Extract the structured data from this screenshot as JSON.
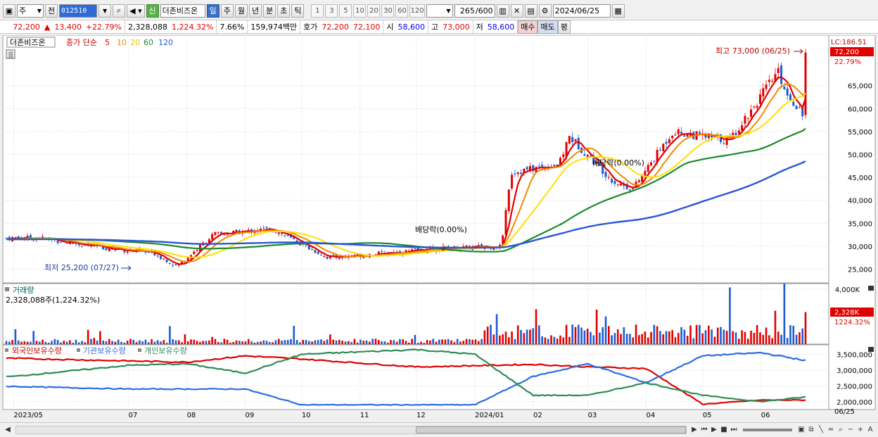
{
  "toolbar": {
    "market_select": "주",
    "prev_label": "전",
    "stock_code": "012510",
    "stock_name": "더존비즈온",
    "credit_badge": "신",
    "periods": [
      "일",
      "주",
      "월",
      "년",
      "분",
      "초",
      "틱"
    ],
    "active_period": "일",
    "intervals": [
      "1",
      "3",
      "5",
      "10",
      "20",
      "30",
      "60",
      "120"
    ],
    "count_value": "265",
    "count_max": "/600",
    "date_value": "2024/06/25"
  },
  "info": {
    "price": "72,200",
    "change_arrow": "▲",
    "change": "13,400",
    "change_rate": "+22.79%",
    "volume": "2,328,088",
    "volume_rate": "1,224.32%",
    "turnover": "7.66%",
    "amount": "159,974백만",
    "quote_label": "호가",
    "ask": "72,200",
    "bid": "72,100",
    "open_label": "시",
    "open": "58,600",
    "high_label": "고",
    "high": "73,000",
    "low_label": "저",
    "low": "58,600",
    "buy_label": "매수",
    "sell_label": "매도",
    "eval_label": "평"
  },
  "colors": {
    "up": "#e00000",
    "down": "#1e5ad2",
    "ma5": "#e00000",
    "ma10": "#f08a00",
    "ma20": "#ffe000",
    "ma60": "#1a8a2a",
    "ma120": "#2a55d8",
    "foreign": "#e00000",
    "institution": "#2a6ee0",
    "individual": "#2e8b57"
  },
  "chart_data": [
    {
      "type": "candlestick",
      "panel": "price",
      "title_stock": "더존비즈온",
      "ma_label": "종가 단순",
      "ma_periods": [
        "5",
        "10",
        "20",
        "60",
        "120"
      ],
      "y_ticks": [
        "25,000",
        "30,000",
        "35,000",
        "40,000",
        "45,000",
        "50,000",
        "55,000",
        "60,000",
        "65,000"
      ],
      "ylim": [
        22000,
        76000
      ],
      "x_ticks": [
        "2023/05",
        "07",
        "08",
        "09",
        "10",
        "11",
        "12",
        "2024/01",
        "02",
        "03",
        "04",
        "05",
        "06"
      ],
      "x_last_label": "06/25",
      "lc_label": "LC:186.51",
      "current_price_label": "72,200",
      "current_rate_label": "22.79%",
      "annotations": [
        {
          "text": "최고 73,000 (06/25)",
          "value": 73000
        },
        {
          "text": "최저 25,200 (07/27)",
          "value": 25200
        },
        {
          "text": "배당락(0.00%)",
          "date": "2023/12"
        },
        {
          "text": "배당락(0.00%)",
          "date": "2024/03"
        }
      ],
      "close_series": [
        {
          "x": "2023/05",
          "y": 31800
        },
        {
          "x": "2023/06",
          "y": 29800
        },
        {
          "x": "2023/07",
          "y": 28400
        },
        {
          "x": "2023/07/27",
          "y": 25600
        },
        {
          "x": "2023/08",
          "y": 32500
        },
        {
          "x": "2023/09",
          "y": 33800
        },
        {
          "x": "2023/10",
          "y": 27500
        },
        {
          "x": "2023/11",
          "y": 28500
        },
        {
          "x": "2023/12",
          "y": 29500
        },
        {
          "x": "2024/01",
          "y": 30000
        },
        {
          "x": "2024/01/20",
          "y": 46000
        },
        {
          "x": "2024/02",
          "y": 48000
        },
        {
          "x": "2024/02/20",
          "y": 54000
        },
        {
          "x": "2024/03",
          "y": 44000
        },
        {
          "x": "2024/03/25",
          "y": 42500
        },
        {
          "x": "2024/04",
          "y": 55000
        },
        {
          "x": "2024/05",
          "y": 53000
        },
        {
          "x": "2024/06",
          "y": 63000
        },
        {
          "x": "2024/06/10",
          "y": 68000
        },
        {
          "x": "2024/06/24",
          "y": 58800
        },
        {
          "x": "2024/06/25",
          "y": 72200
        }
      ]
    },
    {
      "type": "bar",
      "panel": "volume",
      "title": "거래량",
      "value_label": "2,328,088주(1,224.32%)",
      "y_ticks": [
        "4,000K"
      ],
      "current_label": "2,328K",
      "current_rate": "1224.32%",
      "ylim": [
        0,
        4400000
      ]
    },
    {
      "type": "line",
      "panel": "holdings",
      "series": [
        {
          "name": "외국인보유수량",
          "values": [
            {
              "x": "2023/05",
              "y": 3370000
            },
            {
              "x": "2023/08",
              "y": 3250000
            },
            {
              "x": "2023/09",
              "y": 3450000
            },
            {
              "x": "2023/10",
              "y": 3350000
            },
            {
              "x": "2023/12",
              "y": 3100000
            },
            {
              "x": "2024/02",
              "y": 3180000
            },
            {
              "x": "2024/03",
              "y": 3100000
            },
            {
              "x": "2024/04",
              "y": 3050000
            },
            {
              "x": "2024/05",
              "y": 1920000
            },
            {
              "x": "2024/06",
              "y": 2050000
            },
            {
              "x": "2024/06/25",
              "y": 2050000
            }
          ]
        },
        {
          "name": "기관보유수량",
          "values": [
            {
              "x": "2023/05",
              "y": 2480000
            },
            {
              "x": "2023/07",
              "y": 2400000
            },
            {
              "x": "2023/09",
              "y": 2400000
            },
            {
              "x": "2023/10",
              "y": 1900000
            },
            {
              "x": "2024/01",
              "y": 1900000
            },
            {
              "x": "2024/02",
              "y": 2800000
            },
            {
              "x": "2024/03",
              "y": 3200000
            },
            {
              "x": "2024/04",
              "y": 2600000
            },
            {
              "x": "2024/05",
              "y": 3450000
            },
            {
              "x": "2024/06",
              "y": 3550000
            },
            {
              "x": "2024/06/25",
              "y": 3300000
            }
          ]
        },
        {
          "name": "개인보유수량",
          "values": [
            {
              "x": "2023/05",
              "y": 2800000
            },
            {
              "x": "2023/07",
              "y": 3150000
            },
            {
              "x": "2023/08",
              "y": 3200000
            },
            {
              "x": "2023/09",
              "y": 2900000
            },
            {
              "x": "2023/10",
              "y": 3500000
            },
            {
              "x": "2023/12",
              "y": 3650000
            },
            {
              "x": "2024/01",
              "y": 3500000
            },
            {
              "x": "2024/02",
              "y": 2200000
            },
            {
              "x": "2024/03",
              "y": 2200000
            },
            {
              "x": "2024/04",
              "y": 2600000
            },
            {
              "x": "2024/05",
              "y": 2200000
            },
            {
              "x": "2024/06",
              "y": 2000000
            },
            {
              "x": "2024/06/25",
              "y": 2150000
            }
          ]
        }
      ],
      "y_ticks": [
        "2,000,000",
        "2,500,000",
        "3,000,000",
        "3,500,000"
      ],
      "ylim": [
        1750000,
        3800000
      ]
    }
  ]
}
